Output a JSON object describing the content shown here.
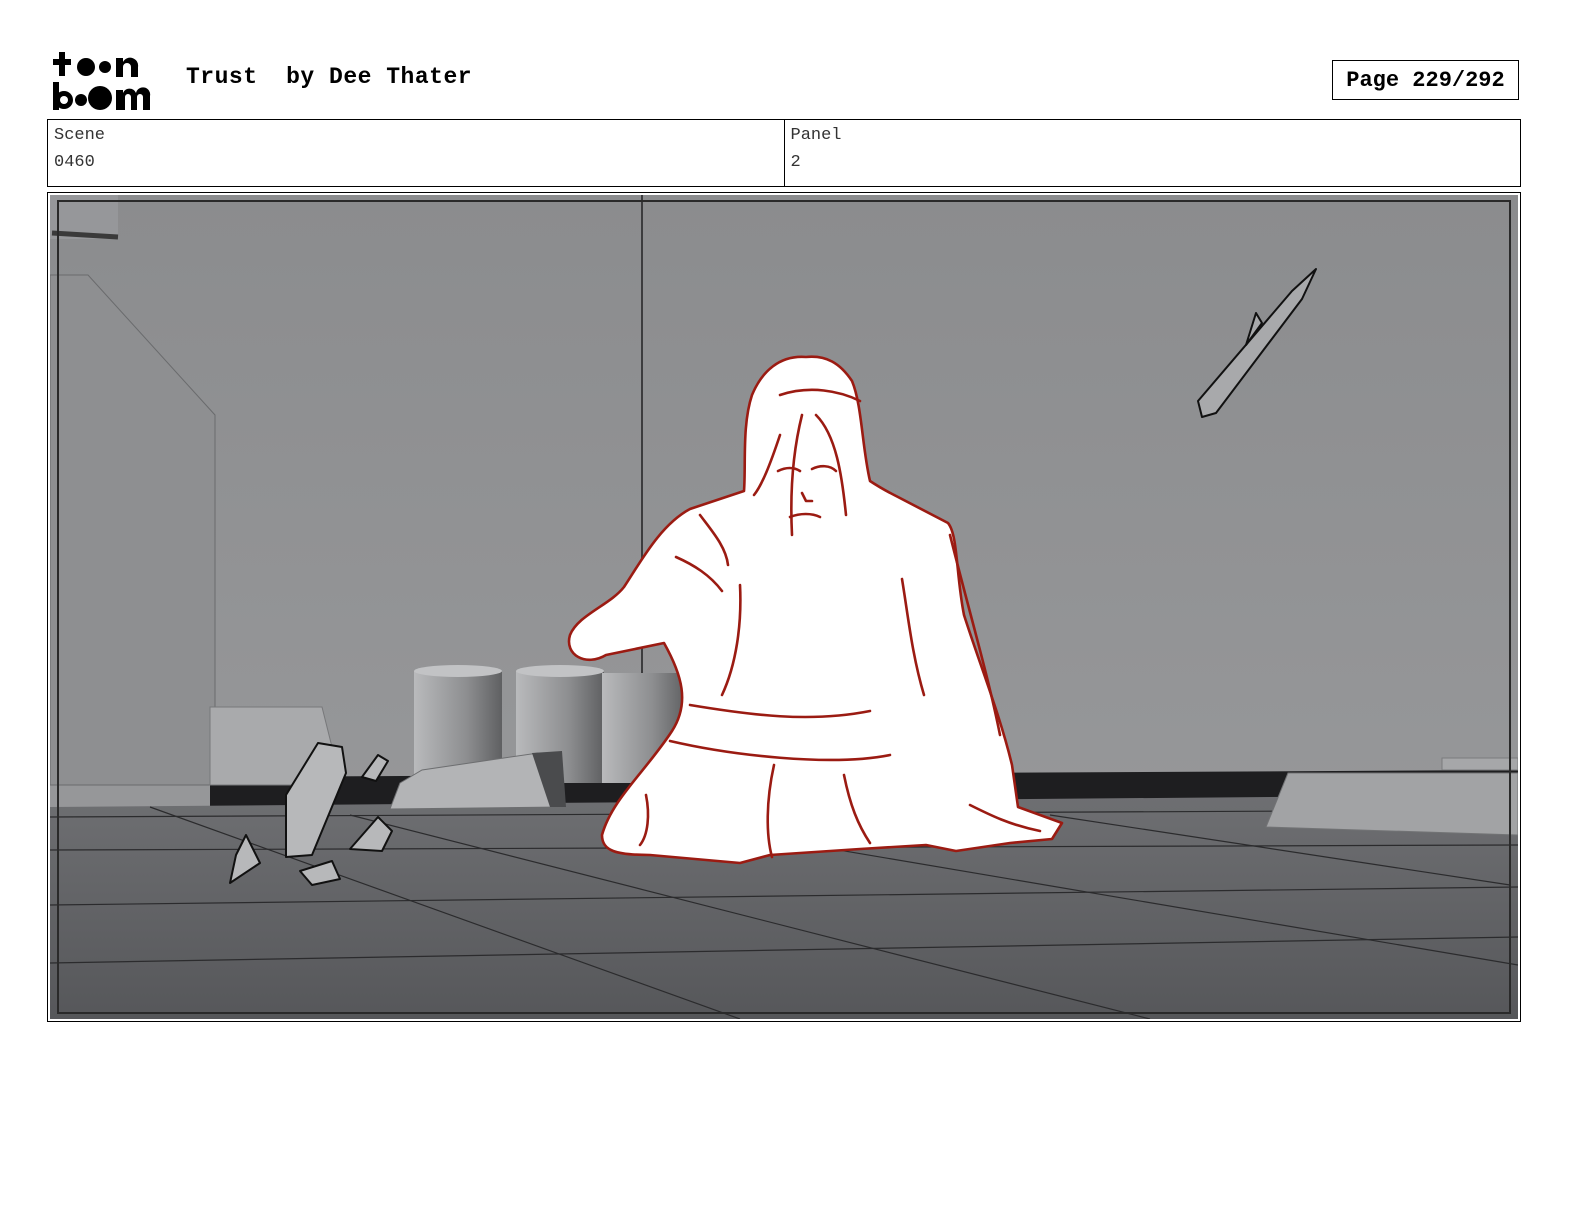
{
  "header": {
    "logo_text": "toon boom",
    "title": "Trust  by Dee Thater",
    "page_label": "Page 229/292"
  },
  "info": {
    "scene_label": "Scene",
    "scene_value": "0460",
    "panel_label": "Panel",
    "panel_value": "2"
  },
  "colors": {
    "sketch_line": "#9b1b12",
    "sky": "#8a8b8d",
    "floor": "#5f6063"
  }
}
